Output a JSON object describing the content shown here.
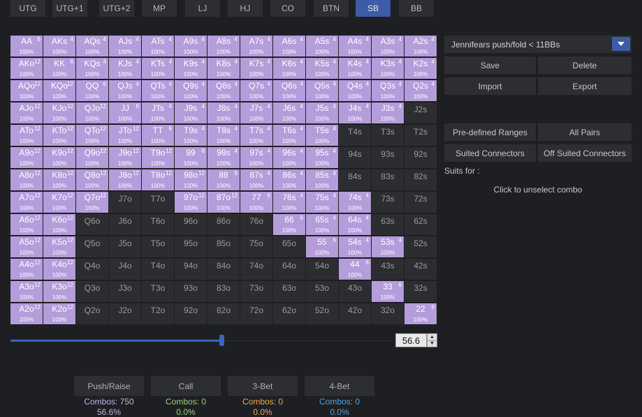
{
  "positions": {
    "items": [
      "UTG",
      "UTG+1",
      "UTG+2",
      "MP",
      "LJ",
      "HJ",
      "CO",
      "BTN",
      "SB",
      "BB"
    ],
    "active": "SB"
  },
  "grid": {
    "rows": [
      [
        [
          "AA",
          "6",
          1
        ],
        [
          "AKs",
          "4",
          1
        ],
        [
          "AQs",
          "4",
          1
        ],
        [
          "AJs",
          "4",
          1
        ],
        [
          "ATs",
          "4",
          1
        ],
        [
          "A9s",
          "4",
          1
        ],
        [
          "A8s",
          "4",
          1
        ],
        [
          "A7s",
          "4",
          1
        ],
        [
          "A6s",
          "4",
          1
        ],
        [
          "A5s",
          "4",
          1
        ],
        [
          "A4s",
          "4",
          1
        ],
        [
          "A3s",
          "4",
          1
        ],
        [
          "A2s",
          "4",
          1
        ]
      ],
      [
        [
          "AKo",
          "12",
          1
        ],
        [
          "KK",
          "6",
          1
        ],
        [
          "KQs",
          "4",
          1
        ],
        [
          "KJs",
          "4",
          1
        ],
        [
          "KTs",
          "4",
          1
        ],
        [
          "K9s",
          "4",
          1
        ],
        [
          "K8s",
          "4",
          1
        ],
        [
          "K7s",
          "4",
          1
        ],
        [
          "K6s",
          "4",
          1
        ],
        [
          "K5s",
          "4",
          1
        ],
        [
          "K4s",
          "4",
          1
        ],
        [
          "K3s",
          "4",
          1
        ],
        [
          "K2s",
          "4",
          1
        ]
      ],
      [
        [
          "AQo",
          "12",
          1
        ],
        [
          "KQo",
          "12",
          1
        ],
        [
          "QQ",
          "6",
          1
        ],
        [
          "QJs",
          "4",
          1
        ],
        [
          "QTs",
          "4",
          1
        ],
        [
          "Q9s",
          "4",
          1
        ],
        [
          "Q8s",
          "4",
          1
        ],
        [
          "Q7s",
          "4",
          1
        ],
        [
          "Q6s",
          "4",
          1
        ],
        [
          "Q5s",
          "4",
          1
        ],
        [
          "Q4s",
          "4",
          1
        ],
        [
          "Q3s",
          "4",
          1
        ],
        [
          "Q2s",
          "4",
          1
        ]
      ],
      [
        [
          "AJo",
          "12",
          1
        ],
        [
          "KJo",
          "12",
          1
        ],
        [
          "QJo",
          "12",
          1
        ],
        [
          "JJ",
          "6",
          1
        ],
        [
          "JTs",
          "4",
          1
        ],
        [
          "J9s",
          "4",
          1
        ],
        [
          "J8s",
          "4",
          1
        ],
        [
          "J7s",
          "4",
          1
        ],
        [
          "J6s",
          "4",
          1
        ],
        [
          "J5s",
          "4",
          1
        ],
        [
          "J4s",
          "4",
          1
        ],
        [
          "J3s",
          "4",
          1
        ],
        [
          "J2s",
          "",
          0
        ]
      ],
      [
        [
          "ATo",
          "12",
          1
        ],
        [
          "KTo",
          "12",
          1
        ],
        [
          "QTo",
          "12",
          1
        ],
        [
          "JTo",
          "12",
          1
        ],
        [
          "TT",
          "6",
          1
        ],
        [
          "T9s",
          "4",
          1
        ],
        [
          "T8s",
          "4",
          1
        ],
        [
          "T7s",
          "4",
          1
        ],
        [
          "T6s",
          "4",
          1
        ],
        [
          "T5s",
          "4",
          1
        ],
        [
          "T4s",
          "",
          0
        ],
        [
          "T3s",
          "",
          0
        ],
        [
          "T2s",
          "",
          0
        ]
      ],
      [
        [
          "A9o",
          "12",
          1
        ],
        [
          "K9o",
          "12",
          1
        ],
        [
          "Q9o",
          "12",
          1
        ],
        [
          "J9o",
          "12",
          1
        ],
        [
          "T9o",
          "12",
          1
        ],
        [
          "99",
          "6",
          1
        ],
        [
          "98s",
          "4",
          1
        ],
        [
          "97s",
          "4",
          1
        ],
        [
          "96s",
          "4",
          1
        ],
        [
          "95s",
          "4",
          1
        ],
        [
          "94s",
          "",
          0
        ],
        [
          "93s",
          "",
          0
        ],
        [
          "92s",
          "",
          0
        ]
      ],
      [
        [
          "A8o",
          "12",
          1
        ],
        [
          "K8o",
          "12",
          1
        ],
        [
          "Q8o",
          "12",
          1
        ],
        [
          "J8o",
          "12",
          1
        ],
        [
          "T8o",
          "12",
          1
        ],
        [
          "98o",
          "12",
          1
        ],
        [
          "88",
          "6",
          1
        ],
        [
          "87s",
          "4",
          1
        ],
        [
          "86s",
          "4",
          1
        ],
        [
          "85s",
          "4",
          1
        ],
        [
          "84s",
          "",
          0
        ],
        [
          "83s",
          "",
          0
        ],
        [
          "82s",
          "",
          0
        ]
      ],
      [
        [
          "A7o",
          "12",
          1
        ],
        [
          "K7o",
          "12",
          1
        ],
        [
          "Q7o",
          "12",
          1
        ],
        [
          "J7o",
          "",
          0
        ],
        [
          "T7o",
          "",
          0
        ],
        [
          "97o",
          "12",
          1
        ],
        [
          "87o",
          "12",
          1
        ],
        [
          "77",
          "6",
          1
        ],
        [
          "76s",
          "4",
          1
        ],
        [
          "75s",
          "4",
          1
        ],
        [
          "74s",
          "4",
          1
        ],
        [
          "73s",
          "",
          0
        ],
        [
          "72s",
          "",
          0
        ]
      ],
      [
        [
          "A6o",
          "12",
          1
        ],
        [
          "K6o",
          "12",
          1
        ],
        [
          "Q6o",
          "",
          0
        ],
        [
          "J6o",
          "",
          0
        ],
        [
          "T6o",
          "",
          0
        ],
        [
          "96o",
          "",
          0
        ],
        [
          "86o",
          "",
          0
        ],
        [
          "76o",
          "",
          0
        ],
        [
          "66",
          "6",
          1
        ],
        [
          "65s",
          "4",
          1
        ],
        [
          "64s",
          "4",
          1
        ],
        [
          "63s",
          "",
          0
        ],
        [
          "62s",
          "",
          0
        ]
      ],
      [
        [
          "A5o",
          "12",
          1
        ],
        [
          "K5o",
          "12",
          1
        ],
        [
          "Q5o",
          "",
          0
        ],
        [
          "J5o",
          "",
          0
        ],
        [
          "T5o",
          "",
          0
        ],
        [
          "95o",
          "",
          0
        ],
        [
          "85o",
          "",
          0
        ],
        [
          "75o",
          "",
          0
        ],
        [
          "65o",
          "",
          0
        ],
        [
          "55",
          "6",
          1
        ],
        [
          "54s",
          "4",
          1
        ],
        [
          "53s",
          "4",
          1
        ],
        [
          "52s",
          "",
          0
        ]
      ],
      [
        [
          "A4o",
          "12",
          1
        ],
        [
          "K4o",
          "12",
          1
        ],
        [
          "Q4o",
          "",
          0
        ],
        [
          "J4o",
          "",
          0
        ],
        [
          "T4o",
          "",
          0
        ],
        [
          "94o",
          "",
          0
        ],
        [
          "84o",
          "",
          0
        ],
        [
          "74o",
          "",
          0
        ],
        [
          "64o",
          "",
          0
        ],
        [
          "54o",
          "",
          0
        ],
        [
          "44",
          "6",
          1
        ],
        [
          "43s",
          "",
          0
        ],
        [
          "42s",
          "",
          0
        ]
      ],
      [
        [
          "A3o",
          "12",
          1
        ],
        [
          "K3o",
          "12",
          1
        ],
        [
          "Q3o",
          "",
          0
        ],
        [
          "J3o",
          "",
          0
        ],
        [
          "T3o",
          "",
          0
        ],
        [
          "93o",
          "",
          0
        ],
        [
          "83o",
          "",
          0
        ],
        [
          "73o",
          "",
          0
        ],
        [
          "63o",
          "",
          0
        ],
        [
          "53o",
          "",
          0
        ],
        [
          "43o",
          "",
          0
        ],
        [
          "33",
          "6",
          1
        ],
        [
          "32s",
          "",
          0
        ]
      ],
      [
        [
          "A2o",
          "12",
          1
        ],
        [
          "K2o",
          "12",
          1
        ],
        [
          "Q2o",
          "",
          0
        ],
        [
          "J2o",
          "",
          0
        ],
        [
          "T2o",
          "",
          0
        ],
        [
          "92o",
          "",
          0
        ],
        [
          "82o",
          "",
          0
        ],
        [
          "72o",
          "",
          0
        ],
        [
          "62o",
          "",
          0
        ],
        [
          "52o",
          "",
          0
        ],
        [
          "42o",
          "",
          0
        ],
        [
          "32o",
          "",
          0
        ],
        [
          "22",
          "6",
          1
        ]
      ]
    ],
    "selected_pct": "100%",
    "selected_color": "#b59ddb"
  },
  "slider": {
    "value": "56.6",
    "fraction": 0.566,
    "up_glyph": "▲",
    "down_glyph": "▼"
  },
  "panel": {
    "range_name": "Jennifears push/fold < 11BBs",
    "dropdown_icon": "chevron-down-icon",
    "save": "Save",
    "delete": "Delete",
    "import": "Import",
    "export": "Export",
    "predefined": "Pre-defined Ranges",
    "all_pairs": "All Pairs",
    "suited_connectors": "Suited Connectors",
    "off_suited_connectors": "Off Suited Connectors",
    "suits_for": "Suits for :",
    "unselect_hint": "Click to unselect combo"
  },
  "actions": [
    {
      "label": "Push/Raise",
      "combos": "Combos: 750",
      "pct": "56.6%",
      "color": "#c3b0e8"
    },
    {
      "label": "Call",
      "combos": "Combos: 0",
      "pct": "0.0%",
      "color": "#9bd27a"
    },
    {
      "label": "3-Bet",
      "combos": "Combos: 0",
      "pct": "0.0%",
      "color": "#f0a85a"
    },
    {
      "label": "4-Bet",
      "combos": "Combos: 0",
      "pct": "0.0%",
      "color": "#4fa8e0"
    }
  ]
}
